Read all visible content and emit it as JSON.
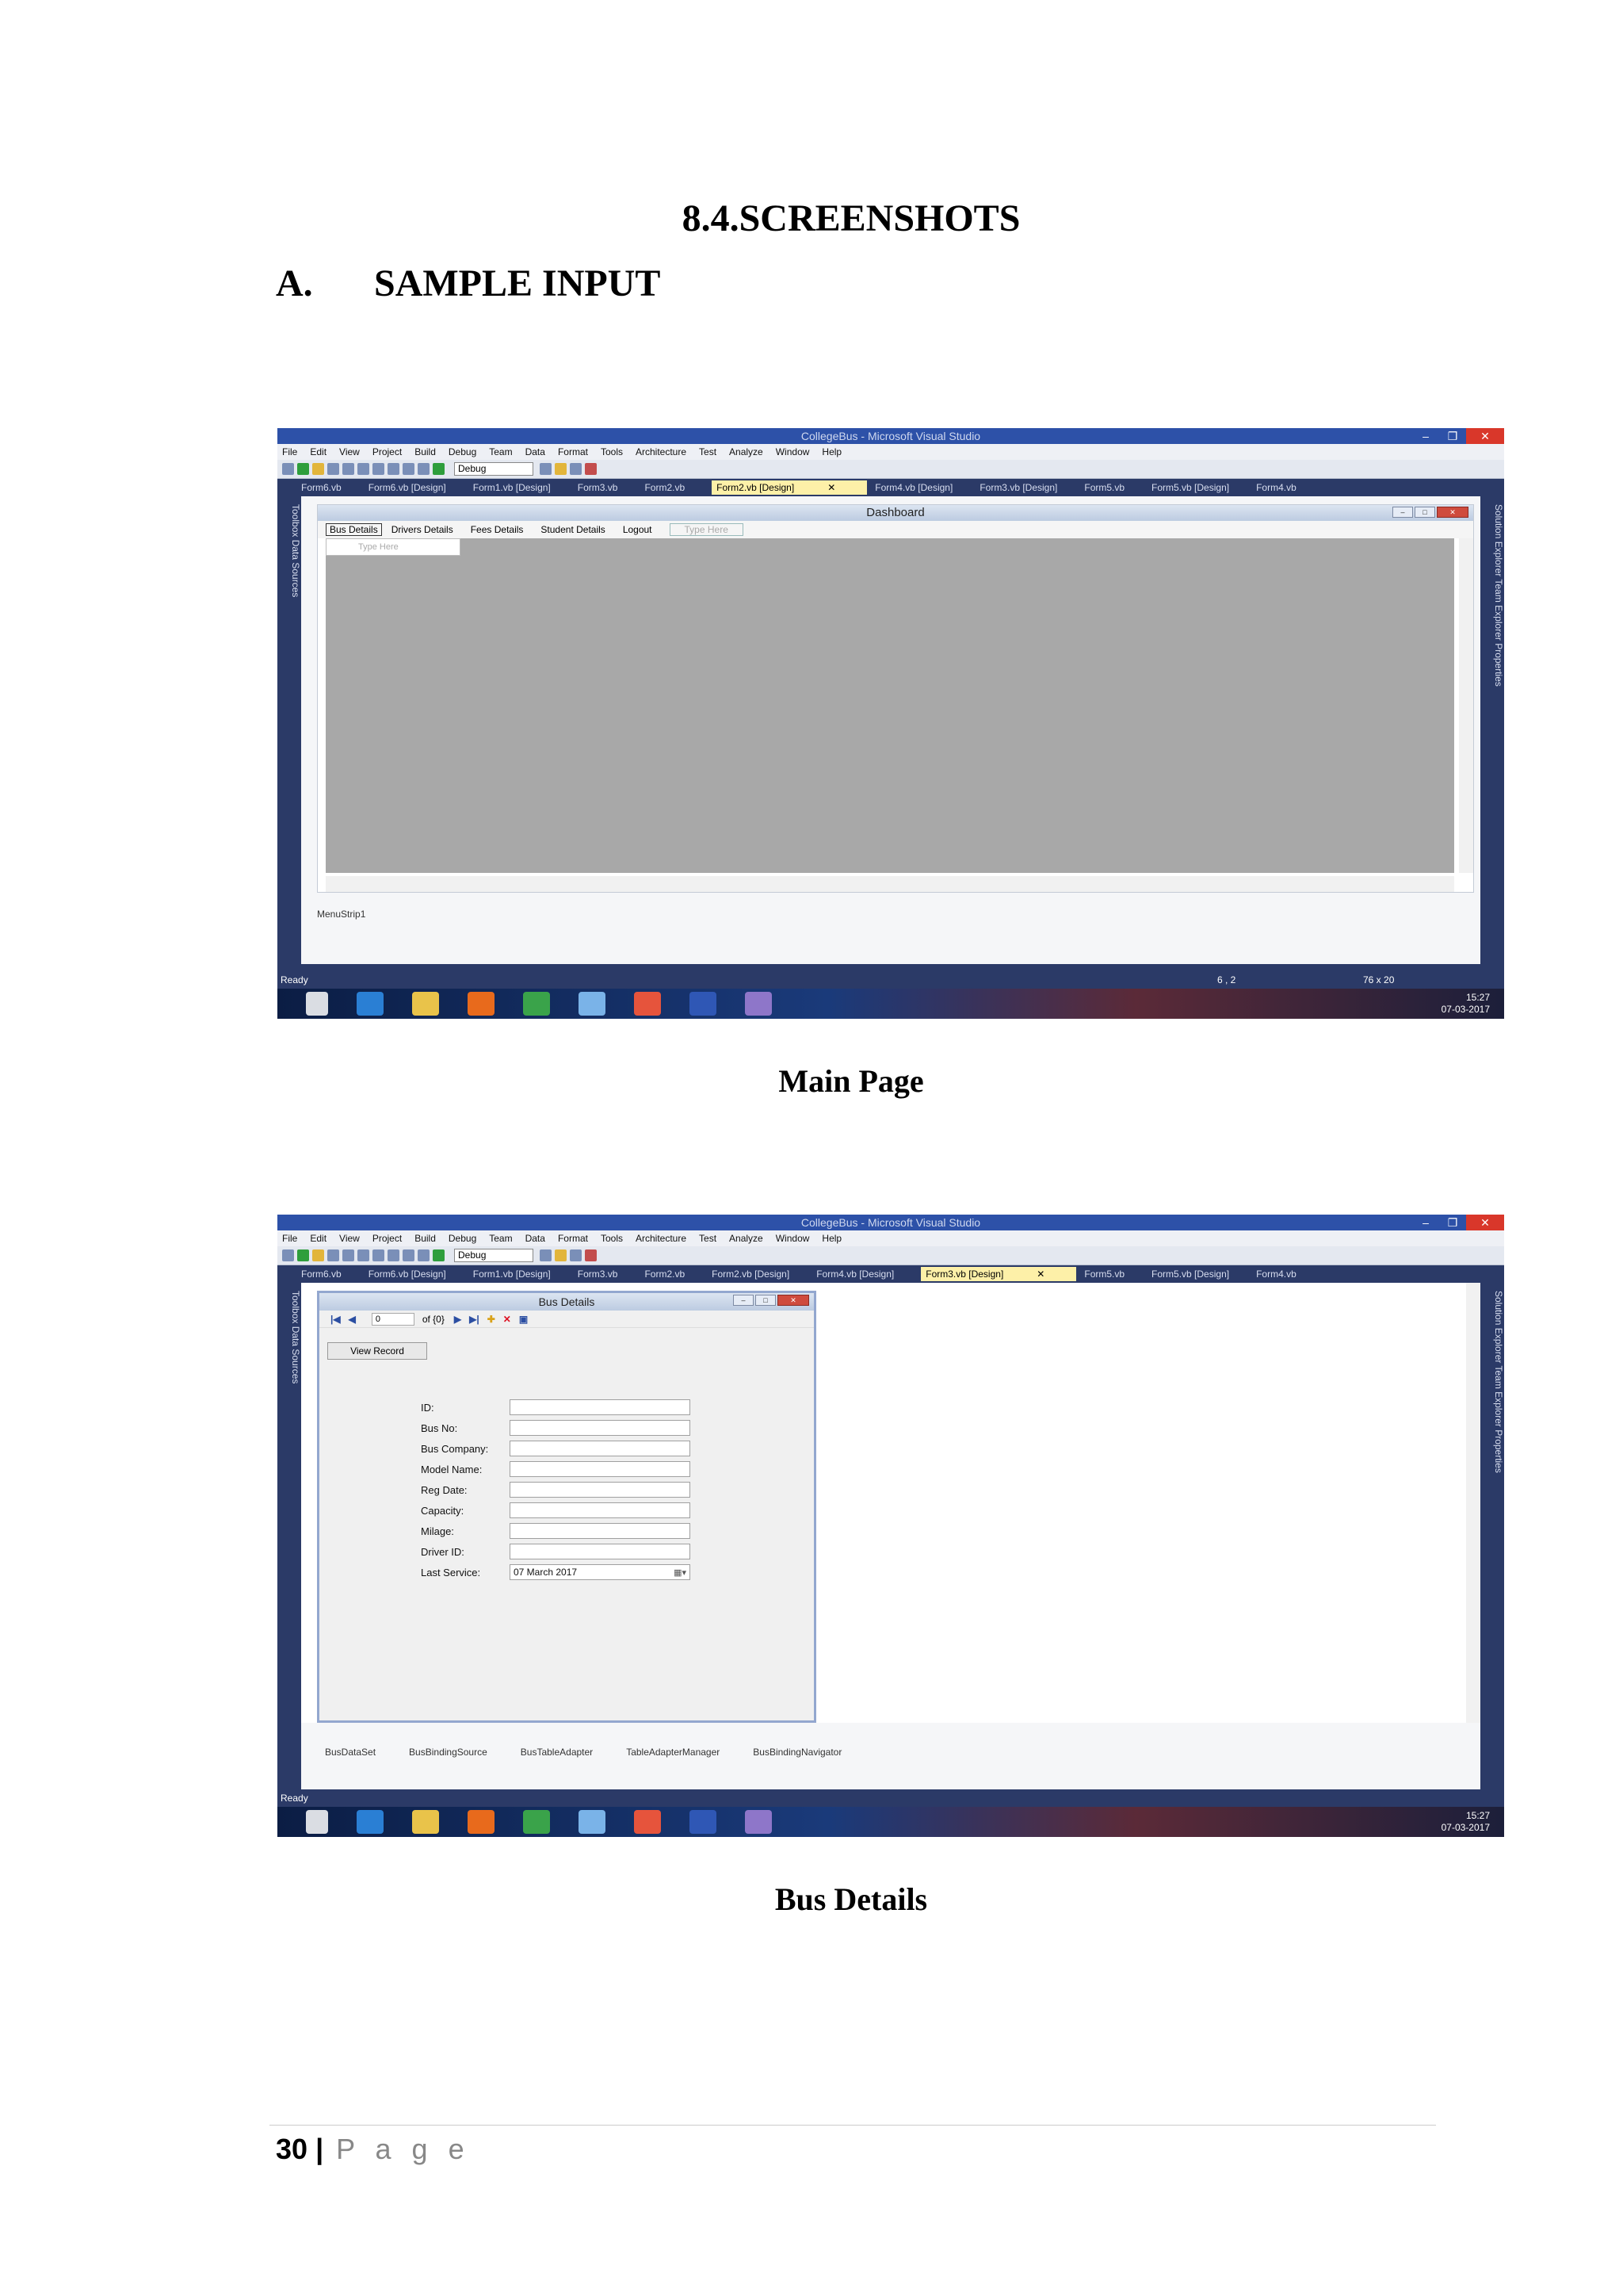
{
  "document": {
    "section_heading": "8.4.SCREENSHOTS",
    "sub_letter": "A.",
    "sub_heading": "SAMPLE INPUT",
    "caption1": "Main Page",
    "caption2": "Bus Details",
    "footer_page": "30",
    "footer_sep": "|",
    "footer_label": "P a g e"
  },
  "vs": {
    "title": "CollegeBus - Microsoft Visual Studio",
    "menu": [
      "File",
      "Edit",
      "View",
      "Project",
      "Build",
      "Debug",
      "Team",
      "Data",
      "Format",
      "Tools",
      "Architecture",
      "Test",
      "Analyze",
      "Window",
      "Help"
    ],
    "config": "Debug",
    "side_left": "Toolbox   Data Sources",
    "side_right": "Solution Explorer   Team Explorer   Properties",
    "status": "Ready",
    "clock_time": "15:27",
    "clock_date": "07-03-2017"
  },
  "shot1": {
    "tabs": [
      "Form6.vb",
      "Form6.vb [Design]",
      "Form1.vb [Design]",
      "Form3.vb",
      "Form2.vb",
      "Form2.vb [Design]",
      "Form4.vb [Design]",
      "Form3.vb [Design]",
      "Form5.vb",
      "Form5.vb [Design]",
      "Form4.vb"
    ],
    "active_tab": "Form2.vb [Design]",
    "form_title": "Dashboard",
    "menu_items": [
      "Bus Details",
      "Drivers Details",
      "Fees Details",
      "Student Details",
      "Logout"
    ],
    "type_here": "Type Here",
    "tray_item": "MenuStrip1",
    "status_pos": "6 , 2",
    "status_size": "76 x 20"
  },
  "shot2": {
    "tabs": [
      "Form6.vb",
      "Form6.vb [Design]",
      "Form1.vb [Design]",
      "Form3.vb",
      "Form2.vb",
      "Form2.vb [Design]",
      "Form4.vb [Design]",
      "Form3.vb [Design]",
      "Form5.vb",
      "Form5.vb [Design]",
      "Form4.vb"
    ],
    "active_tab": "Form3.vb [Design]",
    "form_title": "Bus Details",
    "nav_position": "0",
    "nav_count": "of {0}",
    "view_button": "View Record",
    "fields": [
      "ID:",
      "Bus No:",
      "Bus Company:",
      "Model Name:",
      "Reg Date:",
      "Capacity:",
      "Milage:",
      "Driver ID:",
      "Last Service:"
    ],
    "last_service_value": "07     March     2017",
    "tray_items": [
      "BusDataSet",
      "BusBindingSource",
      "BusTableAdapter",
      "TableAdapterManager",
      "BusBindingNavigator"
    ]
  }
}
